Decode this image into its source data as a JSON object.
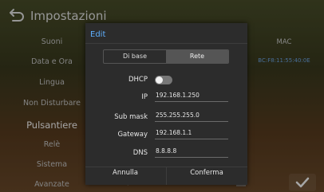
{
  "header": {
    "title": "Impostazioni"
  },
  "sidebar": {
    "items": [
      {
        "label": "Suoni"
      },
      {
        "label": "Data e Ora"
      },
      {
        "label": "Lingua"
      },
      {
        "label": "Non Disturbare"
      },
      {
        "label": "Pulsantiere",
        "active": true
      },
      {
        "label": "Relè"
      },
      {
        "label": "Sistema"
      },
      {
        "label": "Avanzate"
      }
    ]
  },
  "mac": {
    "label": "MAC",
    "value": "BC:F8:11:55:40:0E"
  },
  "dialog": {
    "title": "Edit",
    "tabs": [
      {
        "label": "Di base"
      },
      {
        "label": "Rete",
        "active": true
      }
    ],
    "dhcp": {
      "label": "DHCP",
      "enabled": false
    },
    "fields": {
      "ip": {
        "label": "IP",
        "value": "192.168.1.250"
      },
      "subnet": {
        "label": "Sub mask",
        "value": "255.255.255.0"
      },
      "gateway": {
        "label": "Gateway",
        "value": "192.168.1.1"
      },
      "dns": {
        "label": "DNS",
        "value": "8.8.8.8"
      }
    },
    "cancel_label": "Annulla",
    "confirm_label": "Conferma"
  },
  "colors": {
    "accent": "#5fb0ff",
    "mac_value": "#6fa8e8"
  }
}
